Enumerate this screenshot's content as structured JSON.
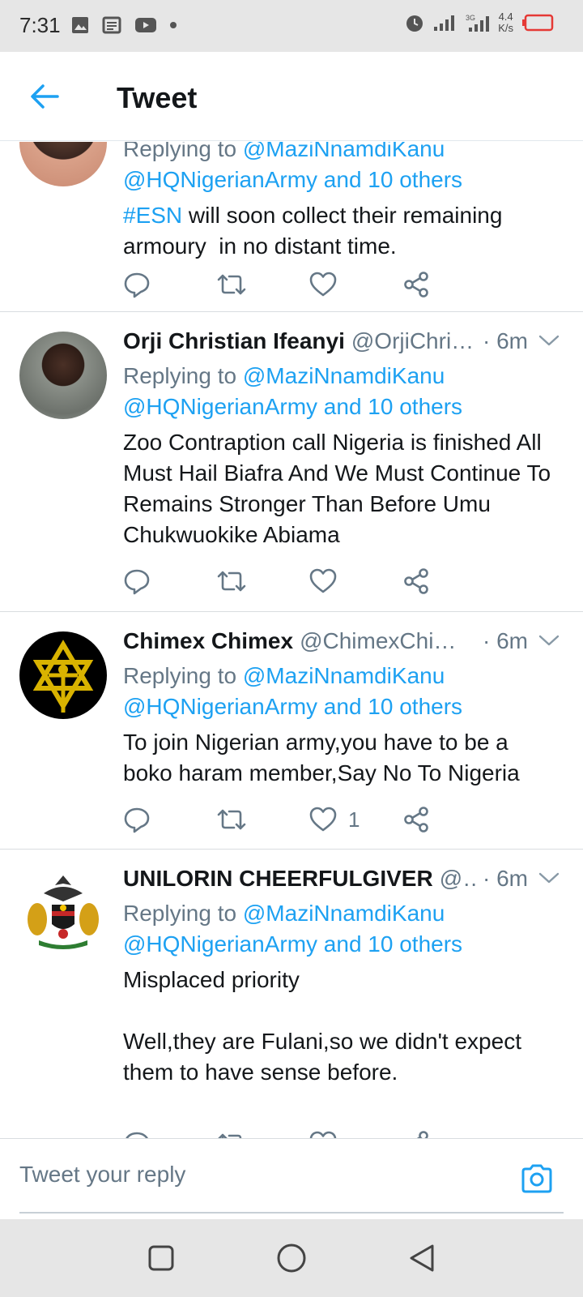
{
  "status_bar": {
    "time": "7:31",
    "net_speed_top": "4.4",
    "net_speed_bottom": "K/s",
    "network": "3G"
  },
  "header": {
    "title": "Tweet"
  },
  "tweets": [
    {
      "name": "",
      "handle": "",
      "time": "",
      "reply_prefix": "Replying to",
      "reply_mention_1": "@MaziNnamdiKanu",
      "reply_mention_2": "@HQNigerianArmy and 10 others",
      "text_hashtag": "#ESN",
      "text": " will soon collect their remaining armoury  in no distant time.",
      "like_count": ""
    },
    {
      "name": "Orji Christian Ifeanyi",
      "handle": "@OrjiChri…",
      "time": "· 6m",
      "reply_prefix": "Replying to",
      "reply_mention_1": "@MaziNnamdiKanu",
      "reply_mention_2": "@HQNigerianArmy and 10 others",
      "text": "Zoo Contraption call Nigeria is finished All Must Hail Biafra And We Must Continue To Remains Stronger Than Before Umu Chukwuokike Abiama",
      "like_count": ""
    },
    {
      "name": "Chimex Chimex",
      "handle": "@ChimexChi…",
      "time": "· 6m",
      "reply_prefix": "Replying to",
      "reply_mention_1": "@MaziNnamdiKanu",
      "reply_mention_2": "@HQNigerianArmy and 10 others",
      "text": "To join Nigerian army,you have to be a boko haram member,Say No To Nigeria",
      "like_count": "1"
    },
    {
      "name": "UNILORIN CHEERFULGIVER",
      "handle": "@…",
      "time": "· 6m",
      "reply_prefix": "Replying to",
      "reply_mention_1": "@MaziNnamdiKanu",
      "reply_mention_2": "@HQNigerianArmy and 10 others",
      "text": "Misplaced priority\n\nWell,they are Fulani,so we didn't expect them to have sense before.",
      "like_count": ""
    }
  ],
  "reply_bar": {
    "placeholder": "Tweet your reply"
  },
  "colors": {
    "accent": "#1da1f2",
    "text": "#14171a",
    "muted": "#657786",
    "icon": "#657786"
  },
  "icons": [
    "back-arrow-icon",
    "reply-icon",
    "retweet-icon",
    "like-icon",
    "share-icon",
    "caret-down-icon",
    "camera-icon"
  ]
}
